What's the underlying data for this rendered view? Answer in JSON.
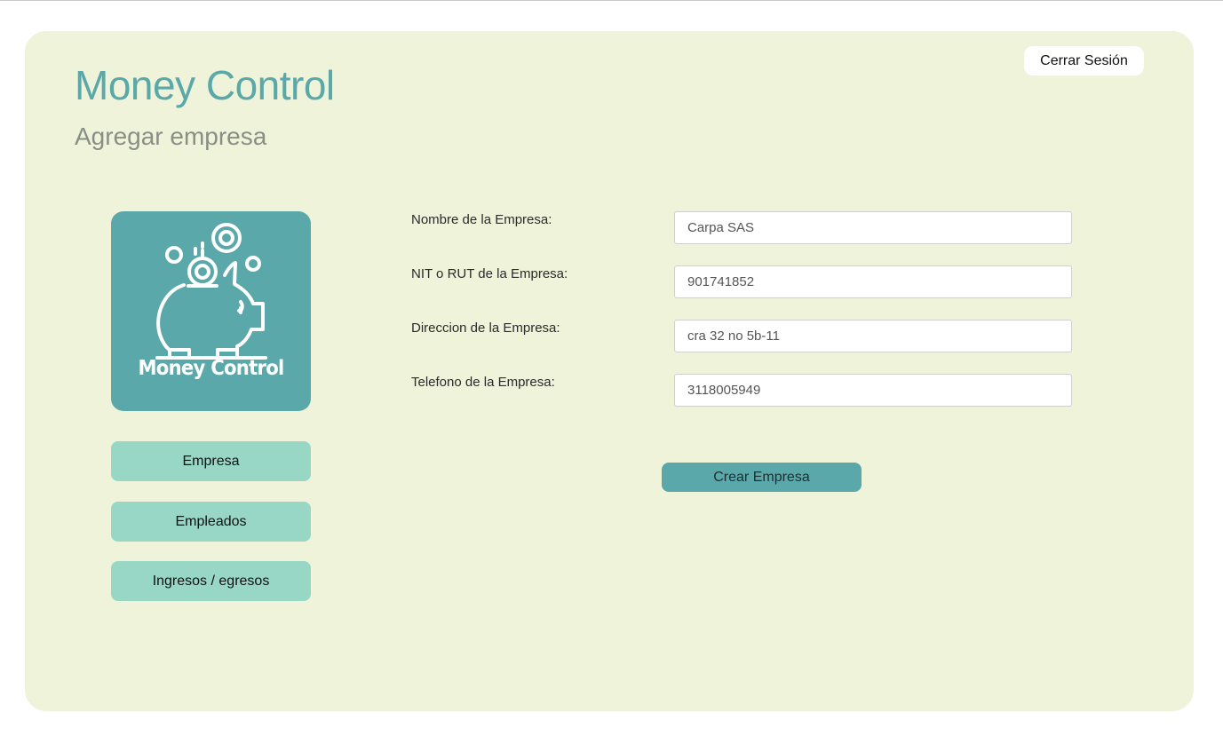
{
  "header": {
    "app_title": "Money Control",
    "page_subtitle": "Agregar empresa",
    "logout_label": "Cerrar Sesión"
  },
  "logo": {
    "text": "Money Control",
    "icon": "piggy-bank-icon"
  },
  "sidebar": {
    "items": [
      {
        "label": "Empresa"
      },
      {
        "label": "Empleados"
      },
      {
        "label": "Ingresos / egresos"
      }
    ]
  },
  "form": {
    "fields": [
      {
        "label": "Nombre de la Empresa:",
        "value": "Carpa SAS"
      },
      {
        "label": "NIT o RUT de la Empresa:",
        "value": "901741852"
      },
      {
        "label": "Direccion de la Empresa:",
        "value": "cra 32 no 5b-11"
      },
      {
        "label": "Telefono de la Empresa:",
        "value": "3118005949"
      }
    ],
    "submit_label": "Crear Empresa"
  },
  "colors": {
    "accent": "#5ba8aa",
    "card_background": "#eff3da",
    "nav_button": "#98d7c5",
    "subtitle": "#8a8f86"
  }
}
